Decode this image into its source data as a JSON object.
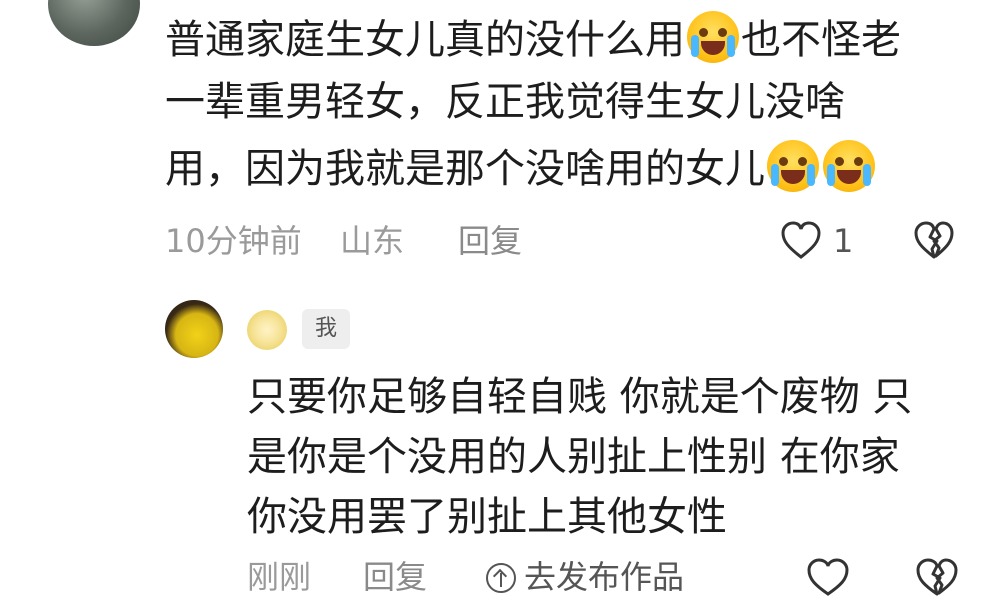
{
  "comment": {
    "line1_a": "普通家庭生女儿真的没什么用",
    "line1_b": "也不怪老",
    "line2": "一辈重男轻女，反正我觉得生女儿没啥",
    "line3": "用，因为我就是那个没啥用的女儿",
    "emojis": [
      "crying-emoji",
      "crying-emoji",
      "crying-emoji"
    ],
    "time": "10分钟前",
    "location": "山东",
    "reply_label": "回复",
    "like_count": "1"
  },
  "reply": {
    "me_tag": "我",
    "line1": "只要你足够自轻自贱 你就是个废物 只",
    "line2": "是你是个没用的人别扯上性别 在你家",
    "line3": "你没用罢了别扯上其他女性",
    "time": "刚刚",
    "reply_label": "回复",
    "publish_label": "去发布作品"
  },
  "colors": {
    "text": "#1d1d1d",
    "meta": "#9a9a9a",
    "emoji": "#ffc21a"
  }
}
